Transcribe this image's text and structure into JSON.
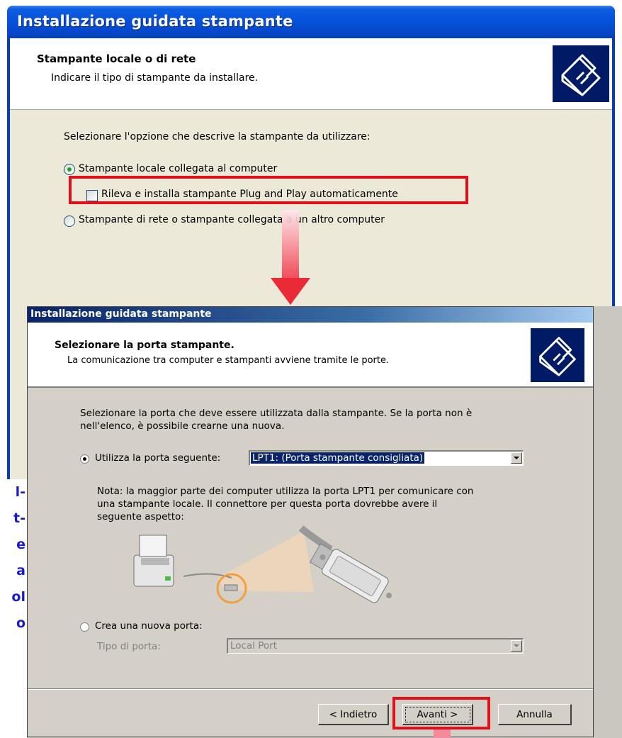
{
  "window1": {
    "title": "Installazione guidata stampante",
    "header_title": "Stampante locale o di rete",
    "header_subtitle": "Indicare il tipo di stampante da installare.",
    "prompt": "Selezionare l'opzione che descrive la stampante da utilizzare:",
    "option_local": "Stampante locale collegata al computer",
    "option_pnp": "Rileva e installa stampante Plug and Play automaticamente",
    "option_network": "Stampante di rete o stampante collegata a un altro computer",
    "option_local_selected": true,
    "option_pnp_checked": false
  },
  "window2": {
    "title": "Installazione guidata stampante",
    "header_title": "Selezionare la porta stampante.",
    "header_subtitle": "La comunicazione tra computer e stampanti avviene tramite le porte.",
    "intro_line1": "Selezionare la porta che deve essere utilizzata dalla stampante. Se la porta non è",
    "intro_line2": "nell'elenco, è possibile crearne una nuova.",
    "use_port_label": "Utilizza la porta seguente:",
    "use_port_value": "LPT1: (Porta stampante consigliata)",
    "note_line1": "Nota: la maggior parte dei computer utilizza la porta LPT1 per comunicare con",
    "note_line2": "una stampante locale. Il connettore per questa porta dovrebbe avere il",
    "note_line3": "seguente aspetto:",
    "create_port_label": "Crea una nuova porta:",
    "port_type_label": "Tipo di porta:",
    "port_type_value": "Local Port",
    "btn_back": "< Indietro",
    "btn_next": "Avanti >",
    "btn_cancel": "Annulla"
  },
  "side_text_fragments": [
    "l-",
    "t-",
    "e",
    "a",
    "ol",
    "o"
  ],
  "colors": {
    "highlight_red": "#e3101a",
    "xp_title_blue": "#0652dc",
    "classic_title_start": "#0a246a",
    "side_text_blue": "#1a1ad0",
    "selection_navy": "#0a246a"
  }
}
